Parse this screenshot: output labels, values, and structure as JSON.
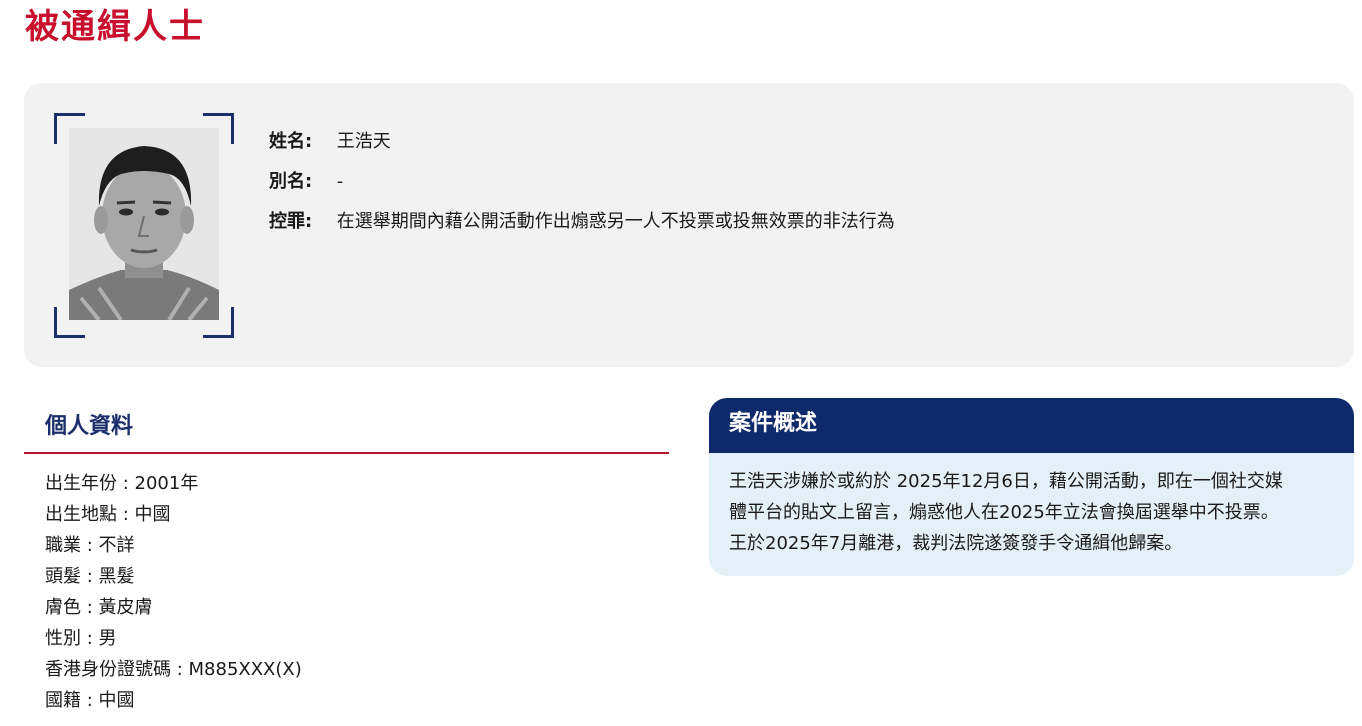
{
  "page": {
    "title": "被通緝人士"
  },
  "profile": {
    "name_label": "姓名:",
    "name_value": "王浩天",
    "alias_label": "別名:",
    "alias_value": "-",
    "charge_label": "控罪:",
    "charge_value": "在選舉期間內藉公開活動作出煽惑另一人不投票或投無效票的非法行為"
  },
  "personal": {
    "heading": "個人資料",
    "rows": [
      "出生年份 : 2001年",
      "出生地點 : 中國",
      "職業 : 不詳",
      "頭髮 : 黑髮",
      "膚色 : 黃皮膚",
      "性別 : 男",
      "香港身份證號碼 : M885XXX(X)",
      "國籍 : 中國"
    ]
  },
  "case": {
    "heading": "案件概述",
    "lines": [
      "王浩天涉嫌於或約於 2025年12月6日，藉公開活動，即在一個社交媒",
      "體平台的貼文上留言，煽惑他人在2025年立法會換屆選舉中不投票。",
      "王於2025年7月離港，裁判法院遂簽發手令通緝他歸案。"
    ]
  },
  "colors": {
    "title_red": "#c8102e",
    "navy": "#0f2a6b",
    "case_bg": "#e3f0f8",
    "card_bg": "#f2f2f2"
  }
}
